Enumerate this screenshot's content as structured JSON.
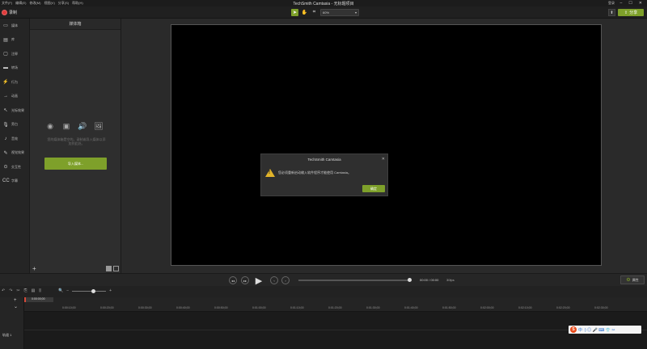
{
  "menu": [
    "文件(F)",
    "编辑(E)",
    "修改(M)",
    "视图(V)",
    "分享(S)",
    "帮助(H)"
  ],
  "app_title": "TechSmith Camtasia - 无标题项目",
  "login": "登录",
  "toolbar": {
    "record_label": "录制",
    "zoom_value": "60%",
    "share_label": "分享"
  },
  "sidebar": {
    "items": [
      {
        "icon": "media-icon",
        "label": "媒体"
      },
      {
        "icon": "library-icon",
        "label": "库"
      },
      {
        "icon": "annotations-icon",
        "label": "注释"
      },
      {
        "icon": "transitions-icon",
        "label": "转场"
      },
      {
        "icon": "behaviors-icon",
        "label": "行为"
      },
      {
        "icon": "animations-icon",
        "label": "动画"
      },
      {
        "icon": "cursor-effects-icon",
        "label": "光标效果"
      },
      {
        "icon": "voice-narration-icon",
        "label": "旁白"
      },
      {
        "icon": "audio-effects-icon",
        "label": "音效"
      },
      {
        "icon": "visual-effects-icon",
        "label": "视觉效果"
      },
      {
        "icon": "interactivity-icon",
        "label": "交互性"
      },
      {
        "icon": "captions-icon",
        "label": "字幕"
      }
    ]
  },
  "bin": {
    "title": "媒体箱",
    "hint": "您的媒体箱是空的。录制或导入媒体以添加到此处。",
    "import_label": "导入媒体..."
  },
  "dialog": {
    "title": "TechSmith Camtasia",
    "message": "您必须重新启动输入软件程序才能使用 Camtasia。",
    "ok_label": "确定"
  },
  "playback": {
    "time": "00:00 / 00:00",
    "fps": "30fps",
    "properties_label": "属性",
    "progress": 0.98
  },
  "timeline": {
    "playhead_time": "0:00:00;00",
    "track_name": "轨道 1",
    "ticks": [
      "0:00:00;00",
      "0:00:10;00",
      "0:00:20;00",
      "0:00:30;00",
      "0:00:40;00",
      "0:00:50;00",
      "0:01:00;00",
      "0:01:10;00",
      "0:01:20;00",
      "0:01:30;00",
      "0:01:40;00",
      "0:01:50;00",
      "0:02:00;00",
      "0:02:10;00",
      "0:02:20;00",
      "0:02:30;00"
    ]
  },
  "tray": {
    "badge": "S",
    "text": "中 ·) ◎ 🎤 ⌨ 👕 ✂"
  }
}
